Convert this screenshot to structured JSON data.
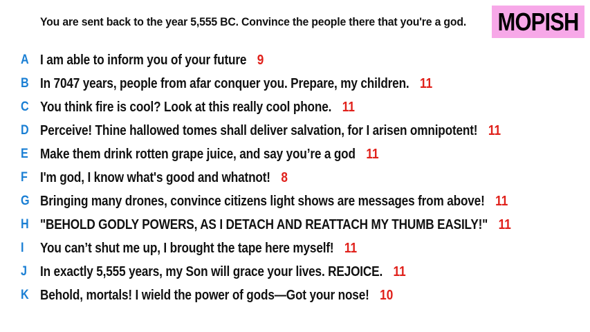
{
  "prompt": "You are sent back to the year 5,555 BC. Convince the people there that you're a god.",
  "badge": "MOPISH",
  "colors": {
    "letter": "#1a7fd4",
    "score": "#e0201a",
    "badge_bg": "#f7a8e8"
  },
  "answers": [
    {
      "letter": "A",
      "text": "I am able to inform you of your future",
      "score": "9"
    },
    {
      "letter": "B",
      "text": "In 7047 years, people from afar conquer you. Prepare, my children.",
      "score": "11"
    },
    {
      "letter": "C",
      "text": "You think fire is cool? Look at this really cool phone.",
      "score": "11"
    },
    {
      "letter": "D",
      "text": "Perceive! Thine hallowed tomes shall deliver salvation, for I arisen omnipotent!",
      "score": "11"
    },
    {
      "letter": "E",
      "text": "Make them drink rotten grape juice, and say you’re a god",
      "score": "11"
    },
    {
      "letter": "F",
      "text": "I'm god, I know what's good and whatnot!",
      "score": "8"
    },
    {
      "letter": "G",
      "text": "Bringing many drones, convince citizens light shows are messages from above!",
      "score": "11"
    },
    {
      "letter": "H",
      "text": "\"BEHOLD GODLY POWERS, AS I DETACH AND REATTACH MY THUMB EASILY!\"",
      "score": "11"
    },
    {
      "letter": "I",
      "text": "You can’t shut me up, I brought the tape here myself!",
      "score": "11"
    },
    {
      "letter": "J",
      "text": "In exactly 5,555 years, my Son will grace your lives. REJOICE.",
      "score": "11"
    },
    {
      "letter": "K",
      "text": "Behold, mortals! I wield the power of gods—Got your nose!",
      "score": "10"
    }
  ]
}
